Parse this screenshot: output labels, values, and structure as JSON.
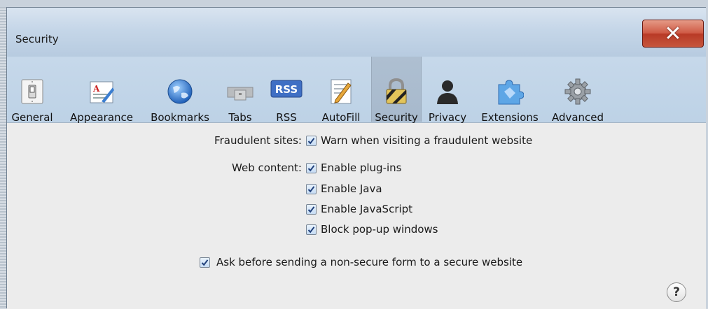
{
  "window": {
    "title": "Security"
  },
  "toolbar": {
    "items": [
      {
        "label": "General",
        "icon": "light-switch-icon"
      },
      {
        "label": "Appearance",
        "icon": "appearance-icon"
      },
      {
        "label": "Bookmarks",
        "icon": "globe-icon"
      },
      {
        "label": "Tabs",
        "icon": "tabs-icon"
      },
      {
        "label": "RSS",
        "icon": "rss-icon",
        "icon_text": "RSS"
      },
      {
        "label": "AutoFill",
        "icon": "pencil-form-icon"
      },
      {
        "label": "Security",
        "icon": "padlock-icon",
        "selected": true
      },
      {
        "label": "Privacy",
        "icon": "person-silhouette-icon"
      },
      {
        "label": "Extensions",
        "icon": "puzzle-icon"
      },
      {
        "label": "Advanced",
        "icon": "gear-icon"
      }
    ]
  },
  "settings": {
    "fraudulent": {
      "label": "Fraudulent sites:",
      "option": {
        "label": "Warn when visiting a fraudulent website",
        "checked": true
      }
    },
    "web_content": {
      "label": "Web content:",
      "options": [
        {
          "label": "Enable plug-ins",
          "checked": true
        },
        {
          "label": "Enable Java",
          "checked": true
        },
        {
          "label": "Enable JavaScript",
          "checked": true
        },
        {
          "label": "Block pop-up windows",
          "checked": true
        }
      ]
    },
    "nonsecure_form": {
      "label": "Ask before sending a non-secure form to a secure website",
      "checked": true
    }
  },
  "help": {
    "label": "?"
  },
  "close": {
    "label": "✕"
  },
  "colors": {
    "titlebar": "#c5d6e8",
    "close_red": "#c6553c",
    "content_bg": "#ececec"
  }
}
